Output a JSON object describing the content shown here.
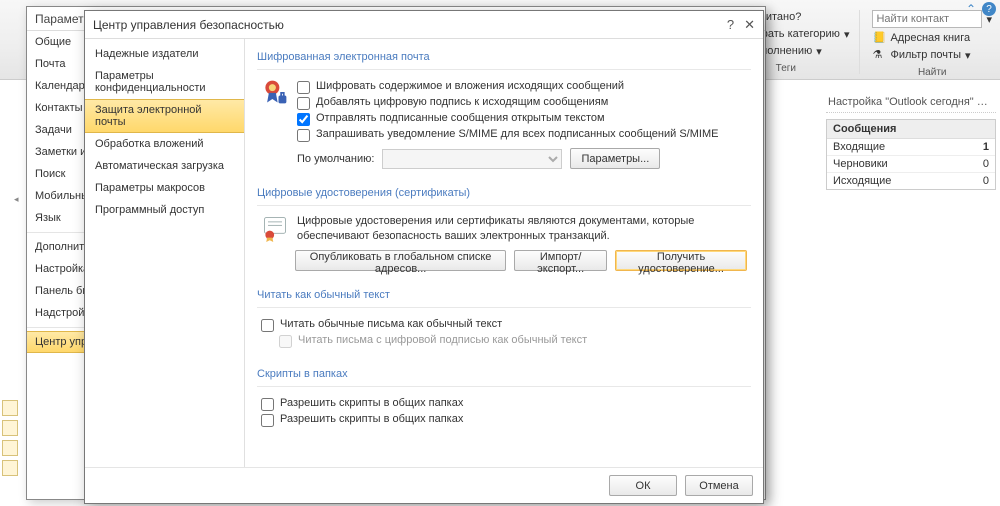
{
  "ribbon": {
    "read_label": "Прочитано?",
    "category_label": "Выбрать категорию",
    "followup_label": "К исполнению",
    "tags_group": "Теги",
    "find_group": "Найти",
    "find_contact_placeholder": "Найти контакт",
    "address_book": "Адресная книга",
    "mail_filter": "Фильтр почты"
  },
  "today": {
    "title": "Настройка \"Outlook сегодня\" …",
    "section": "Сообщения",
    "rows": [
      {
        "label": "Входящие",
        "value": "1",
        "bold": true
      },
      {
        "label": "Черновики",
        "value": "0"
      },
      {
        "label": "Исходящие",
        "value": "0"
      }
    ]
  },
  "options": {
    "title": "Параметры O…",
    "nav": [
      "Общие",
      "Почта",
      "Календарь",
      "Контакты",
      "Задачи",
      "Заметки и д…",
      "Поиск",
      "Мобильные…",
      "Язык",
      "Дополнител…",
      "Настройка л…",
      "Панель быст…",
      "Надстройки",
      "Центр управ…"
    ],
    "selected_index": 13
  },
  "trust": {
    "title": "Центр управления безопасностью",
    "nav": [
      "Надежные издатели",
      "Параметры конфиденциальности",
      "Защита электронной почты",
      "Обработка вложений",
      "Автоматическая загрузка",
      "Параметры макросов",
      "Программный доступ"
    ],
    "selected_index": 2,
    "encrypted": {
      "title": "Шифрованная электронная почта",
      "opts": [
        "Шифровать содержимое и вложения исходящих сообщений",
        "Добавлять цифровую подпись к исходящим сообщениям",
        "Отправлять подписанные сообщения открытым текстом",
        "Запрашивать уведомление S/MIME для всех подписанных сообщений S/MIME"
      ],
      "checked": [
        false,
        false,
        true,
        false
      ],
      "default_label": "По умолчанию:",
      "params_btn": "Параметры..."
    },
    "certs": {
      "title": "Цифровые удостоверения (сертификаты)",
      "desc": "Цифровые удостоверения или сертификаты являются документами, которые обеспечивают безопасность ваших электронных транзакций.",
      "publish_btn": "Опубликовать в глобальном списке адресов...",
      "import_btn": "Импорт/экспорт...",
      "get_btn": "Получить удостоверение..."
    },
    "plain": {
      "title": "Читать как обычный текст",
      "opt1": "Читать обычные письма как обычный текст",
      "opt2": "Читать письма с цифровой подписью как обычный текст"
    },
    "scripts": {
      "title": "Скрипты в папках",
      "opt1": "Разрешить скрипты в общих папках",
      "opt2": "Разрешить скрипты в общих папках"
    },
    "footer": {
      "ok": "ОК",
      "cancel": "Отмена"
    }
  }
}
